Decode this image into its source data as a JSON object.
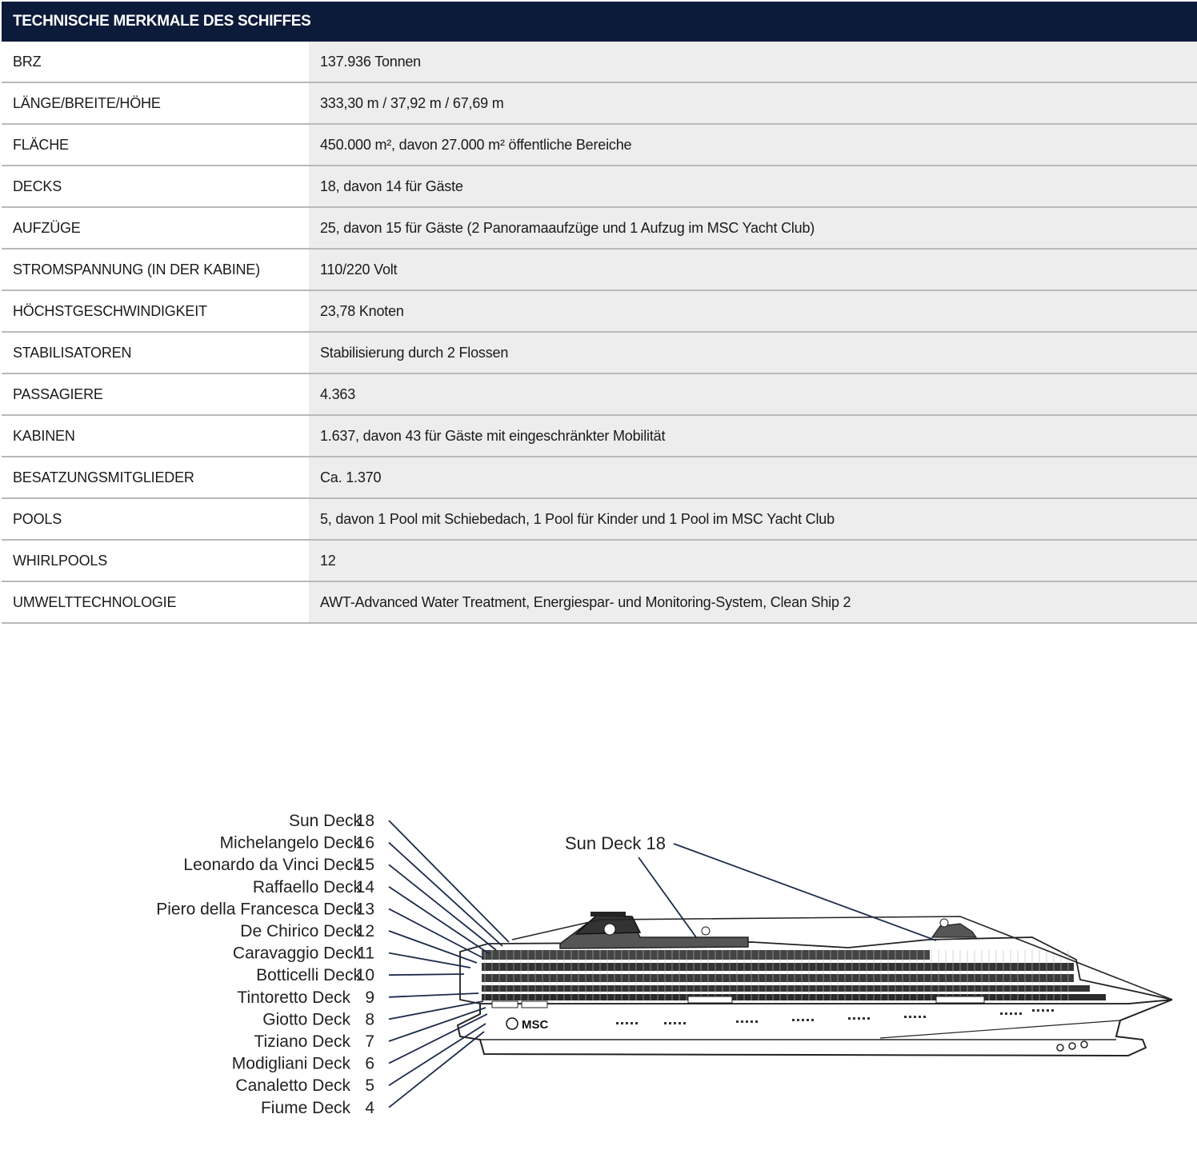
{
  "table": {
    "title": "TECHNISCHE MERKMALE DES SCHIFFES",
    "rows": [
      {
        "label": "BRZ",
        "value": "137.936 Tonnen"
      },
      {
        "label": "LÄNGE/BREITE/HÖHE",
        "value": "333,30 m / 37,92 m / 67,69 m"
      },
      {
        "label": "FLÄCHE",
        "value": "450.000 m², davon 27.000 m² öffentliche Bereiche"
      },
      {
        "label": "DECKS",
        "value": "18, davon 14 für Gäste"
      },
      {
        "label": "AUFZÜGE",
        "value": "25, davon 15 für Gäste (2 Panoramaaufzüge und 1 Aufzug im MSC Yacht Club)"
      },
      {
        "label": "STROMSPANNUNG (IN DER KABINE)",
        "value": "110/220 Volt"
      },
      {
        "label": "HÖCHSTGESCHWINDIGKEIT",
        "value": "23,78 Knoten"
      },
      {
        "label": "STABILISATOREN",
        "value": "Stabilisierung durch 2 Flossen"
      },
      {
        "label": "PASSAGIERE",
        "value": "4.363"
      },
      {
        "label": "KABINEN",
        "value": "1.637, davon 43 für Gäste mit eingeschränkter Mobilität"
      },
      {
        "label": "BESATZUNGSMITGLIEDER",
        "value": "Ca. 1.370"
      },
      {
        "label": "POOLS",
        "value": "5, davon 1 Pool mit Schiebedach, 1 Pool für Kinder und 1 Pool im MSC Yacht Club"
      },
      {
        "label": "WHIRLPOOLS",
        "value": "12"
      },
      {
        "label": "UMWELTTECHNOLOGIE",
        "value": "AWT-Advanced Water Treatment, Energiespar- und Monitoring-System, Clean Ship 2"
      }
    ]
  },
  "diagram": {
    "decks": [
      {
        "name": "Sun Deck",
        "number": "18"
      },
      {
        "name": "Michelangelo Deck",
        "number": "16"
      },
      {
        "name": "Leonardo da Vinci Deck",
        "number": "15"
      },
      {
        "name": "Raffaello Deck",
        "number": "14"
      },
      {
        "name": "Piero della Francesca Deck",
        "number": "13"
      },
      {
        "name": "De Chirico Deck",
        "number": "12"
      },
      {
        "name": "Caravaggio Deck",
        "number": "11"
      },
      {
        "name": "Botticelli Deck",
        "number": "10"
      },
      {
        "name": "Tintoretto Deck",
        "number": "9"
      },
      {
        "name": "Giotto Deck",
        "number": "8"
      },
      {
        "name": "Tiziano Deck",
        "number": "7"
      },
      {
        "name": "Modigliani Deck",
        "number": "6"
      },
      {
        "name": "Canaletto Deck",
        "number": "5"
      },
      {
        "name": "Fiume Deck",
        "number": "4"
      }
    ],
    "sun_deck_callout": "Sun Deck 18",
    "hull_logo": "MSC"
  }
}
